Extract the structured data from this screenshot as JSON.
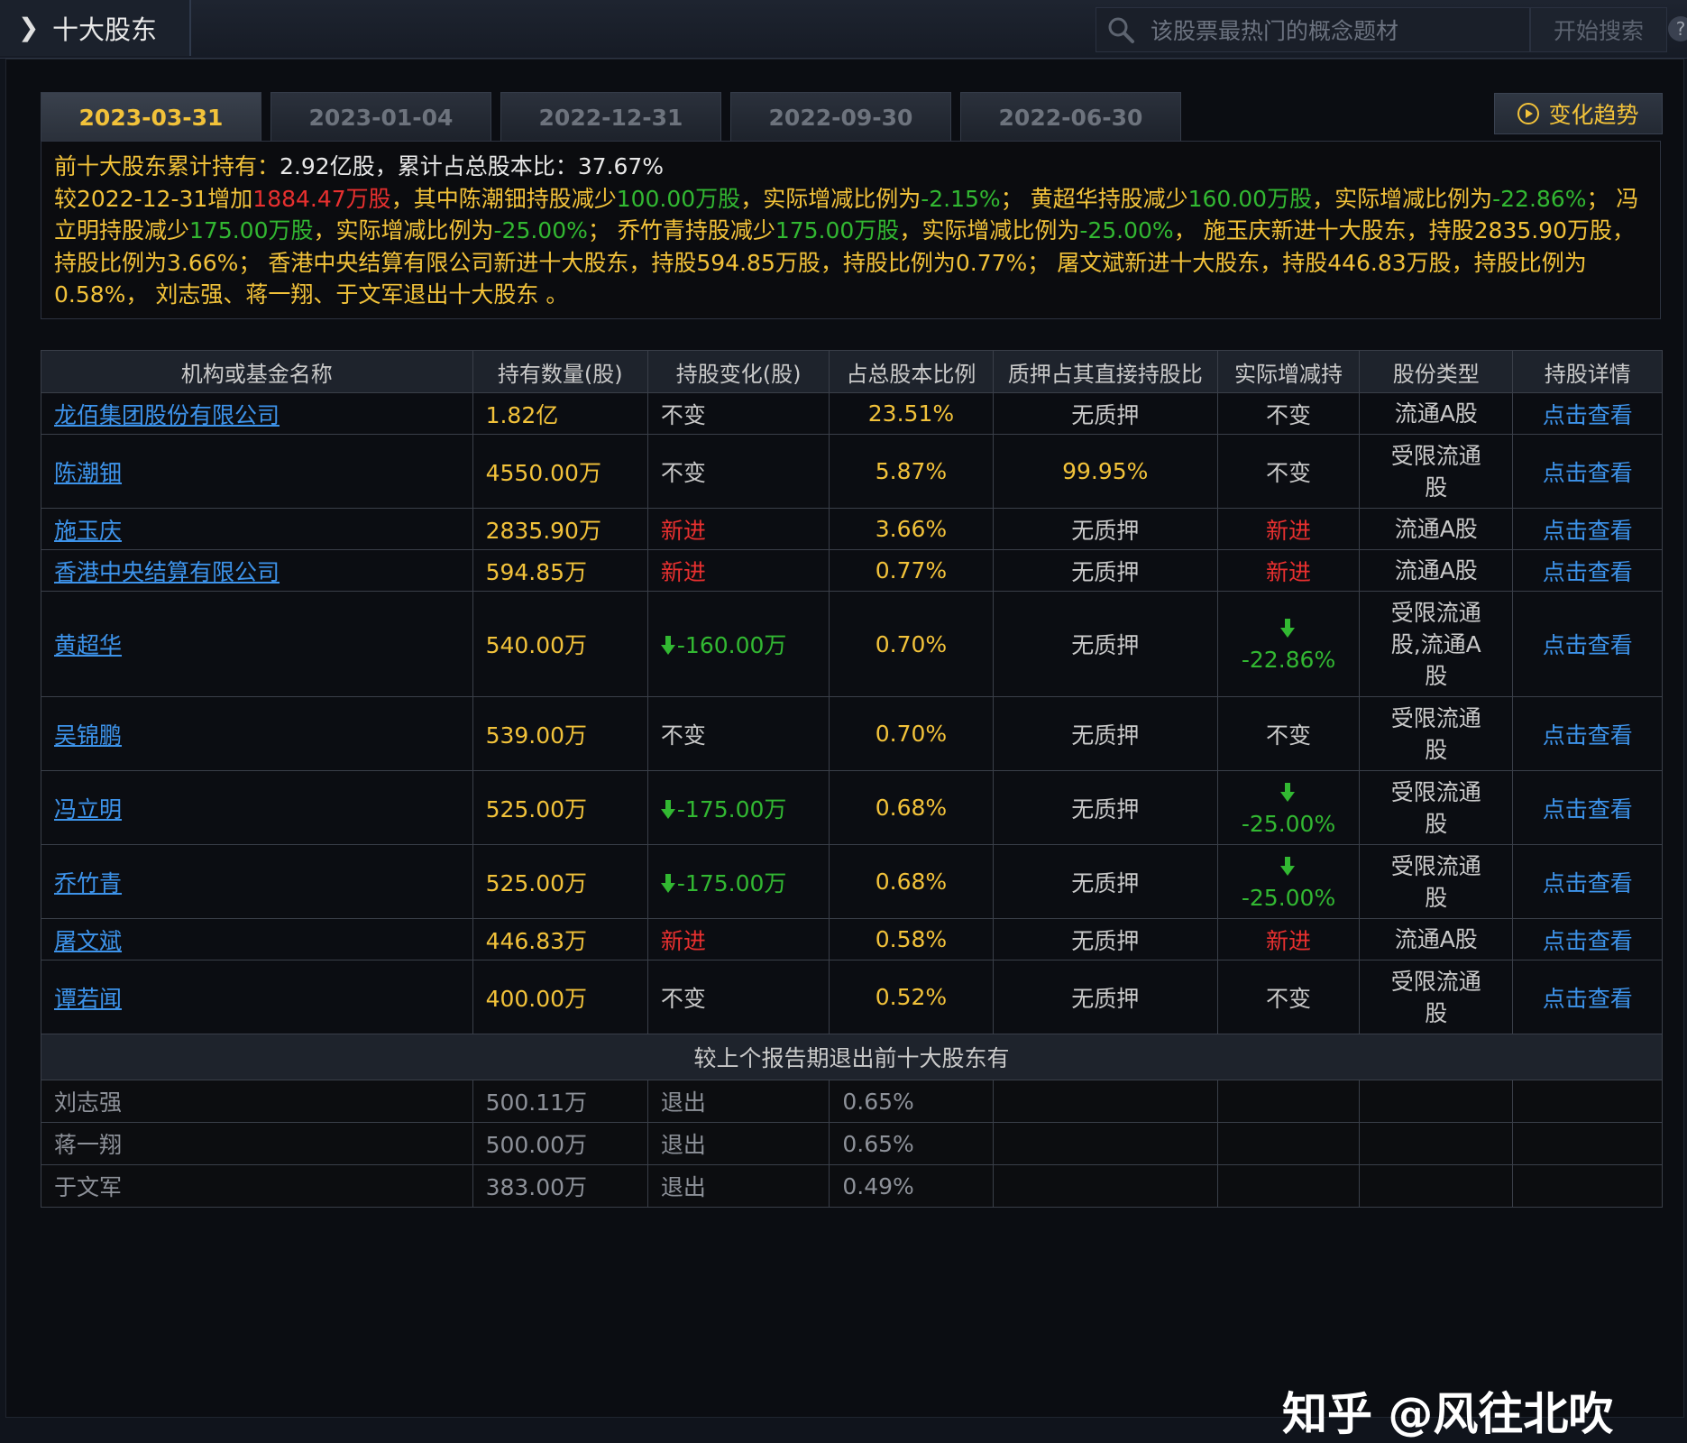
{
  "header": {
    "title": "十大股东",
    "search_placeholder": "该股票最热门的概念题材",
    "search_button": "开始搜索"
  },
  "tabs": [
    {
      "label": "2023-03-31",
      "active": true
    },
    {
      "label": "2023-01-04",
      "active": false
    },
    {
      "label": "2022-12-31",
      "active": false
    },
    {
      "label": "2022-09-30",
      "active": false
    },
    {
      "label": "2022-06-30",
      "active": false
    }
  ],
  "trend_button": "变化趋势",
  "summary": {
    "p1": "前十大股东累计持有：",
    "v1": "2.92",
    "p2": "亿股，累计占总股本比：",
    "v2": "37.67%",
    "p3": "较2022-12-31增加",
    "v3": "1884.47万股",
    "p4": "，其中陈潮钿持股减少",
    "v4": "100.00万股",
    "p5": "，实际增减比例为",
    "v5": "-2.15%",
    "p6": "； 黄超华持股减少",
    "v6": "160.00万股",
    "p7": "，实际增减比例为",
    "v7": "-22.86%",
    "p8": "； 冯立明持股减少",
    "v8": "175.00万股",
    "p9": "，实际增减比例为",
    "v9": "-25.00%",
    "p10": "； 乔竹青持股减少",
    "v10": "175.00万股",
    "p11": "，实际增减比例为",
    "v11": "-25.00%",
    "p12": "， 施玉庆新进十大股东，持股2835.90万股，持股比例为3.66%； 香港中央结算有限公司新进十大股东，持股594.85万股，持股比例为0.77%； 屠文斌新进十大股东，持股446.83万股，持股比例为0.58%， 刘志强、蒋一翔、于文军退出十大股东 。"
  },
  "columns": [
    "机构或基金名称",
    "持有数量(股)",
    "持股变化(股)",
    "占总股本比例",
    "质押占其直接持股比",
    "实际增减持",
    "股份类型",
    "持股详情"
  ],
  "rows": [
    {
      "name": "龙佰集团股份有限公司",
      "qty": "1.82亿",
      "change": "不变",
      "change_type": "same",
      "ratio": "23.51%",
      "pledge": "无质押",
      "actual": "不变",
      "actual_type": "same",
      "share_type": "流通A股",
      "detail": "点击查看",
      "h": 46
    },
    {
      "name": "陈潮钿",
      "qty": "4550.00万",
      "change": "不变",
      "change_type": "same",
      "ratio": "5.87%",
      "pledge": "99.95%",
      "actual": "不变",
      "actual_type": "same",
      "share_type": "受限流通股",
      "detail": "点击查看",
      "h": 82
    },
    {
      "name": "施玉庆",
      "qty": "2835.90万",
      "change": "新进",
      "change_type": "new",
      "ratio": "3.66%",
      "pledge": "无质押",
      "actual": "新进",
      "actual_type": "new",
      "share_type": "流通A股",
      "detail": "点击查看",
      "h": 46
    },
    {
      "name": "香港中央结算有限公司",
      "qty": "594.85万",
      "change": "新进",
      "change_type": "new",
      "ratio": "0.77%",
      "pledge": "无质押",
      "actual": "新进",
      "actual_type": "new",
      "share_type": "流通A股",
      "detail": "点击查看",
      "h": 46
    },
    {
      "name": "黄超华",
      "qty": "540.00万",
      "change": "-160.00万",
      "change_type": "down",
      "ratio": "0.70%",
      "pledge": "无质押",
      "actual": "-22.86%",
      "actual_type": "down",
      "share_type": "受限流通股,流通A股",
      "detail": "点击查看",
      "h": 117
    },
    {
      "name": "吴锦鹏",
      "qty": "539.00万",
      "change": "不变",
      "change_type": "same",
      "ratio": "0.70%",
      "pledge": "无质押",
      "actual": "不变",
      "actual_type": "same",
      "share_type": "受限流通股",
      "detail": "点击查看",
      "h": 82
    },
    {
      "name": "冯立明",
      "qty": "525.00万",
      "change": "-175.00万",
      "change_type": "down",
      "ratio": "0.68%",
      "pledge": "无质押",
      "actual": "-25.00%",
      "actual_type": "down",
      "share_type": "受限流通股",
      "detail": "点击查看",
      "h": 82
    },
    {
      "name": "乔竹青",
      "qty": "525.00万",
      "change": "-175.00万",
      "change_type": "down",
      "ratio": "0.68%",
      "pledge": "无质押",
      "actual": "-25.00%",
      "actual_type": "down",
      "share_type": "受限流通股",
      "detail": "点击查看",
      "h": 82
    },
    {
      "name": "屠文斌",
      "qty": "446.83万",
      "change": "新进",
      "change_type": "new",
      "ratio": "0.58%",
      "pledge": "无质押",
      "actual": "新进",
      "actual_type": "new",
      "share_type": "流通A股",
      "detail": "点击查看",
      "h": 46
    },
    {
      "name": "谭若闻",
      "qty": "400.00万",
      "change": "不变",
      "change_type": "same",
      "ratio": "0.52%",
      "pledge": "无质押",
      "actual": "不变",
      "actual_type": "same",
      "share_type": "受限流通股",
      "detail": "点击查看",
      "h": 82
    }
  ],
  "exit_title": "较上个报告期退出前十大股东有",
  "exit_rows": [
    {
      "name": "刘志强",
      "qty": "500.11万",
      "change": "退出",
      "ratio": "0.65%"
    },
    {
      "name": "蒋一翔",
      "qty": "500.00万",
      "change": "退出",
      "ratio": "0.65%"
    },
    {
      "name": "于文军",
      "qty": "383.00万",
      "change": "退出",
      "ratio": "0.49%"
    }
  ],
  "watermark": "知乎 @风往北吹"
}
